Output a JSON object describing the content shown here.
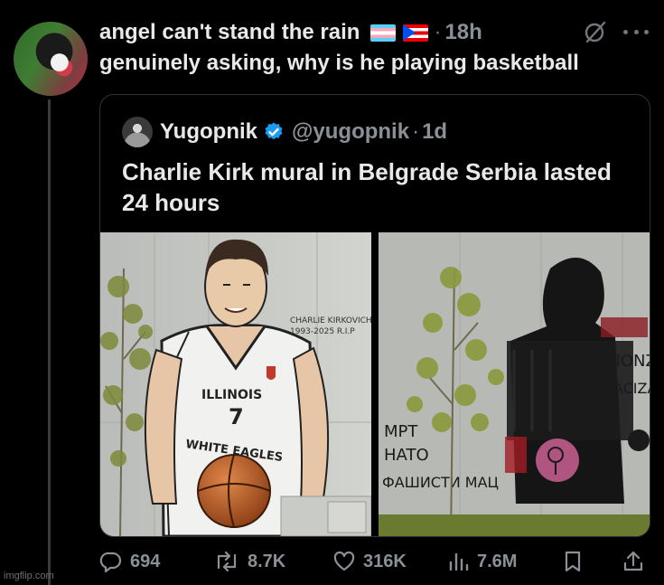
{
  "tweet": {
    "author_name": "angel can't stand the rain",
    "flags": [
      "transgender-flag",
      "puerto-rico-flag"
    ],
    "separator": "·",
    "time": "18h",
    "text": "genuinely asking, why is he playing basketball"
  },
  "quoted_tweet": {
    "author_name": "Yugopnik",
    "verified": true,
    "handle": "@yugopnik",
    "separator": "·",
    "time": "1d",
    "text": "Charlie Kirk mural in Belgrade Serbia lasted 24 hours",
    "images": [
      {
        "name": "mural-before",
        "mural_text": [
          "CHARLIE KIRKOVICH",
          "1993-2025 R.I.P"
        ],
        "jersey_text": [
          "ILLINOIS",
          "7",
          "WHITE EAGLES"
        ]
      },
      {
        "name": "mural-after",
        "graffiti_text": [
          "MPT",
          "HATO",
          "ФАШИСТИ МАЦ",
          "CIONZ",
          "NACIZA"
        ]
      }
    ]
  },
  "actions": {
    "replies": "694",
    "reposts": "8.7K",
    "likes": "316K",
    "views": "7.6M"
  },
  "icons": [
    "grok-icon",
    "more-icon",
    "verified-icon",
    "reply-icon",
    "repost-icon",
    "like-icon",
    "views-icon",
    "bookmark-icon",
    "share-icon"
  ],
  "colors": {
    "background": "#000000",
    "text": "#e7e9ea",
    "muted": "#8b9096",
    "verified": "#1d9bf0",
    "border": "#2f3336"
  },
  "watermark": "imgflip.com"
}
